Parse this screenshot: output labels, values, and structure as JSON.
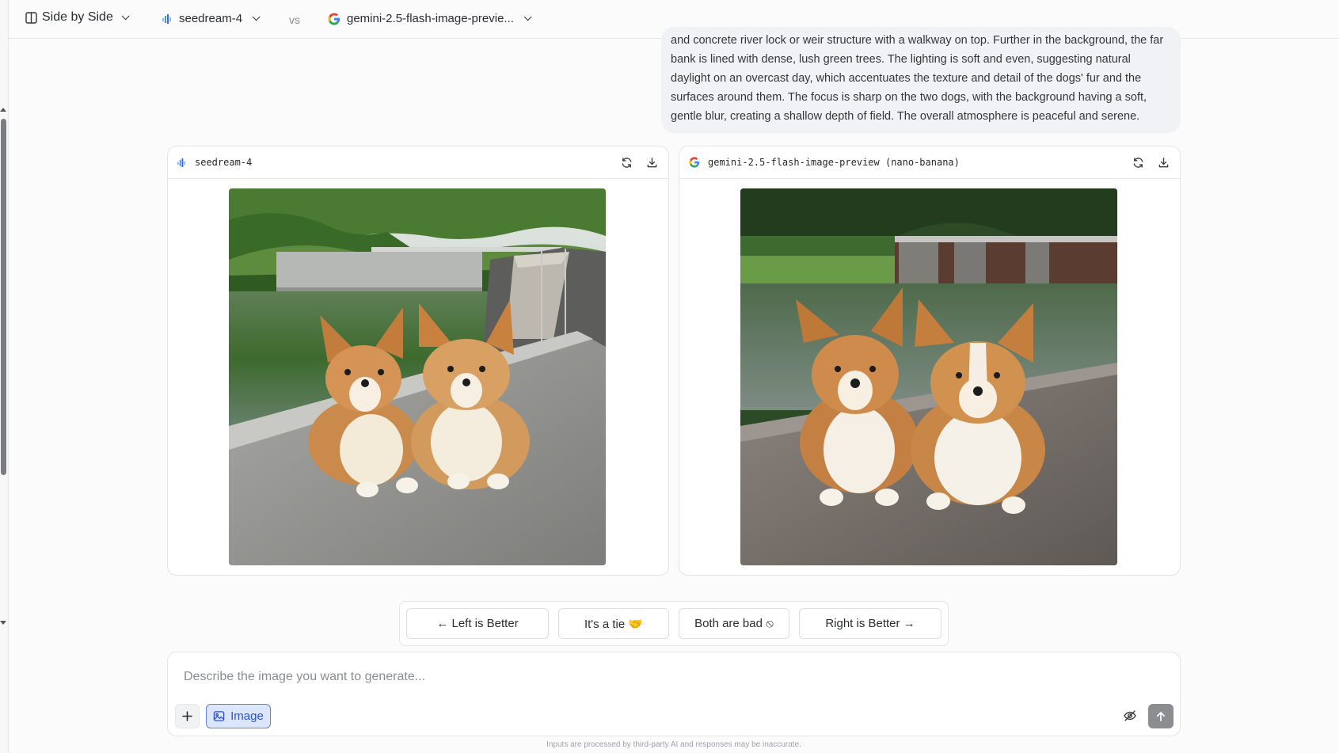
{
  "header": {
    "mode_label": "Side by Side",
    "model_a": "seedream-4",
    "vs_label": "vs",
    "model_b": "gemini-2.5-flash-image-previe..."
  },
  "prompt": {
    "text": "and concrete river lock or weir structure with a walkway on top. Further in the background, the far bank is lined with dense, lush green trees. The lighting is soft and even, suggesting natural daylight on an overcast day, which accentuates the texture and detail of the dogs' fur and the surfaces around them. The focus is sharp on the two dogs, with the background having a soft, gentle blur, creating a shallow depth of field. The overall atmosphere is peaceful and serene."
  },
  "cards": {
    "left": {
      "model_name": "seedream-4",
      "image_alt": "Two corgis lying on a concrete pier beside a river with a lock and walkway"
    },
    "right": {
      "model_name": "gemini-2.5-flash-image-preview (nano-banana)",
      "image_alt": "Two corgis sitting on a stone ledge in front of a river weir structure"
    }
  },
  "vote": {
    "left_better": "← Left is Better",
    "tie": "It's a tie 🤝",
    "both_bad": "Both are bad ⦸",
    "right_better": "Right is Better →"
  },
  "composer": {
    "placeholder": "Describe the image you want to generate...",
    "image_mode_label": "Image"
  },
  "footer": {
    "disclaimer": "Inputs are processed by third-party AI and responses may be inaccurate."
  },
  "colors": {
    "accent_blue": "#2e55c7",
    "image_btn_bg": "#dbe5fb",
    "seedream_brand": "#4a8df5"
  }
}
